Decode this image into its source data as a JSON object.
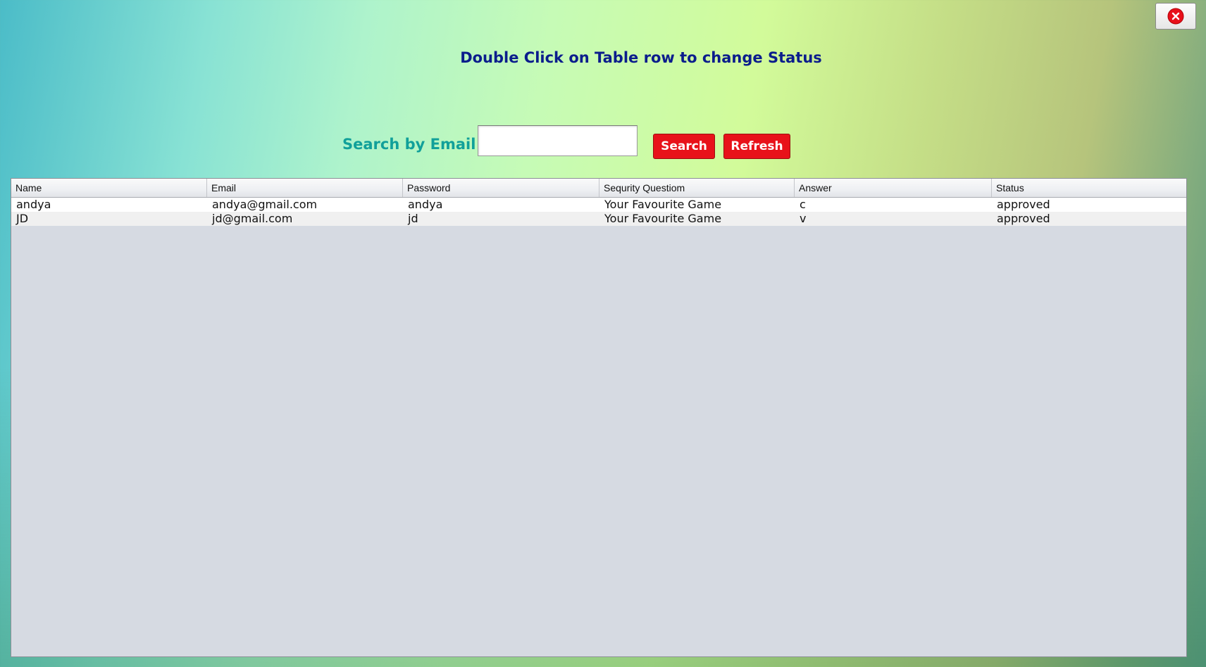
{
  "header": {
    "title": "Double Click on Table row to change Status",
    "close_icon": "close-icon"
  },
  "search": {
    "label": "Search by Email",
    "value": "",
    "placeholder": "",
    "search_button": "Search",
    "refresh_button": "Refresh"
  },
  "colors": {
    "title": "#0b1d8c",
    "search_label": "#11a09a",
    "button_red": "#e8121a",
    "table_bg": "#d6dae2"
  },
  "table": {
    "columns": [
      "Name",
      "Email",
      "Password",
      "Sequrity Questiom",
      "Answer",
      "Status"
    ],
    "rows": [
      [
        "andya",
        "andya@gmail.com",
        "andya",
        "Your Favourite Game",
        "c",
        "approved"
      ],
      [
        "JD",
        "jd@gmail.com",
        "jd",
        "Your Favourite Game",
        "v",
        "approved"
      ]
    ]
  }
}
